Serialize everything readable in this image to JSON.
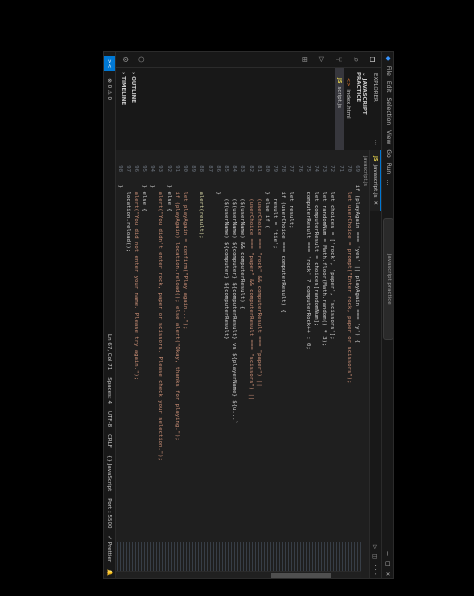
{
  "titlebar": {
    "menu": [
      "File",
      "Edit",
      "Selection",
      "View",
      "Go",
      "Run",
      "…"
    ],
    "command_center": "javascript practice"
  },
  "sidebar": {
    "header": "EXPLORER",
    "section": "JAVASCRIPT PRACTICE",
    "files": [
      {
        "name": "index.html",
        "icon": "html-file-icon"
      },
      {
        "name": "script.js",
        "icon": "js-file-icon",
        "selected": true
      }
    ],
    "outline": "OUTLINE",
    "timeline": "TIMELINE"
  },
  "tabs": [
    {
      "label": "javascript.js",
      "icon": "js-file-icon"
    }
  ],
  "breadcrumb": "javascript.js",
  "code": [
    {
      "n": "69",
      "t": "  if (playAgain === 'yes' || playAgain === 'y') {"
    },
    {
      "n": "70",
      "t": "    let userChoice = prompt(\"Enter rock, paper or scissors\");"
    },
    {
      "n": "71",
      "t": ""
    },
    {
      "n": "72",
      "t": "    let choices = ['rock', 'paper', 'scissors'];"
    },
    {
      "n": "73",
      "t": "    let randomNum = Math.floor(Math.random() * 3);"
    },
    {
      "n": "74",
      "t": "    let computerResult = choices[randomNum];"
    },
    {
      "n": "75",
      "t": "    computerResult === 'rock' ? computerRock++ : 0;"
    },
    {
      "n": "76",
      "t": ""
    },
    {
      "n": "77",
      "t": "    let result;"
    },
    {
      "n": "78",
      "t": "    if (userChoice === computerResult) {"
    },
    {
      "n": "79",
      "t": "      result = 'tie';"
    },
    {
      "n": "80",
      "t": "    } else if ("
    },
    {
      "n": "81",
      "t": "      (userChoice === \"rock\" && computerResult === \"paper\") ||"
    },
    {
      "n": "82",
      "t": "      (userChoice === \"paper\" && computerResult === \"scissors\") ||"
    },
    {
      "n": "83",
      "t": "      ($(userName) && computerResult) {"
    },
    {
      "n": "84",
      "t": "      ($(userName) ${computer} ${computerResult} vs ${playerName} ${u...`"
    },
    {
      "n": "85",
      "t": "      ($(userName) ${computer} ${computerResult}"
    },
    {
      "n": "86",
      "t": "    }"
    },
    {
      "n": "87",
      "t": ""
    },
    {
      "n": "88",
      "t": "    alert(result);"
    },
    {
      "n": "89",
      "t": ""
    },
    {
      "n": "90",
      "t": "    let playAgain = confirm(\"Play again...\");"
    },
    {
      "n": "91",
      "t": "    if (playAgain) location.reload(); else alert(\"Okay, thanks for playing.\");"
    },
    {
      "n": "92",
      "t": "  } else {"
    },
    {
      "n": "93",
      "t": "    alert(\"You didn't enter rock, paper or scissors. Please check your selection.\");"
    },
    {
      "n": "94",
      "t": "  }"
    },
    {
      "n": "95",
      "t": "  } else {"
    },
    {
      "n": "96",
      "t": "    alert(\"You did not enter your name. Please try again.\");"
    },
    {
      "n": "97",
      "t": "    location.reload();"
    },
    {
      "n": "98",
      "t": "  }"
    },
    {
      "n": "99",
      "t": "} else {"
    },
    {
      "n": "100",
      "t": "  alert(\"I guess you changed your mind. Maybe next time.\");"
    },
    {
      "n": "101",
      "t": "}"
    }
  ],
  "statusbar": {
    "remote": "><",
    "errors": "⊗ 0  ⚠ 0",
    "position": "Ln 67, Col 71",
    "spaces": "Spaces: 4",
    "encoding": "UTF-8",
    "eol": "CRLF",
    "language": "{} JavaScript",
    "port": "Port : 5500",
    "prettier": "✓ Prettier"
  }
}
